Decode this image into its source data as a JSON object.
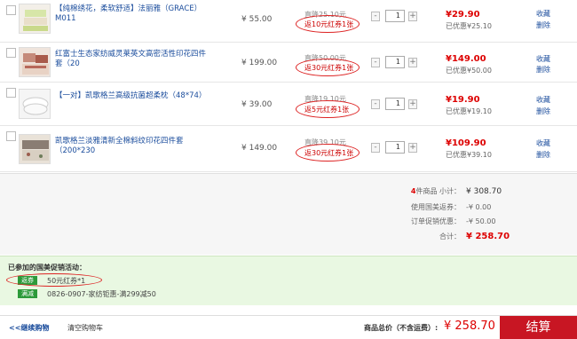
{
  "items": [
    {
      "name": "【纯棉绣花，柔软舒适】法丽雅（GRACE）M011",
      "price": "¥ 55.00",
      "discount": "直降25.10元",
      "coupon": "返10元红券1张",
      "qty": "1",
      "subtotal": "¥29.90",
      "saved": "已优惠¥25.10",
      "fav": "收藏",
      "del": "删除"
    },
    {
      "name": "红富士生态家纺威灵莱英文高密活性印花四件套（20",
      "price": "¥ 199.00",
      "discount": "直降50.00元",
      "coupon": "返30元红券1张",
      "qty": "1",
      "subtotal": "¥149.00",
      "saved": "已优惠¥50.00",
      "fav": "收藏",
      "del": "删除"
    },
    {
      "name": "【一对】凯歌格兰高级抗菌超柔枕（48*74）",
      "price": "¥ 39.00",
      "discount": "直降19.10元",
      "coupon": "返5元红券1张",
      "qty": "1",
      "subtotal": "¥19.90",
      "saved": "已优惠¥19.10",
      "fav": "收藏",
      "del": "删除"
    },
    {
      "name": "凯歌格兰淡雅清新全棉斜纹印花四件套（200*230",
      "price": "¥ 149.00",
      "discount": "直降39.10元",
      "coupon": "返30元红券1张",
      "qty": "1",
      "subtotal": "¥109.90",
      "saved": "已优惠¥39.10",
      "fav": "收藏",
      "del": "删除"
    }
  ],
  "summary": {
    "count_num": "4",
    "count_label": "件商品 小计：",
    "subtotal": "¥ 308.70",
    "coupon_label": "使用国美返券：",
    "coupon_value": "-¥ 0.00",
    "promo_label": "订单促销优惠：",
    "promo_value": "-¥ 50.00",
    "total_label": "合计：",
    "total_value": "¥ 258.70"
  },
  "promo": {
    "title": "已参加的国美促销活动：",
    "badge1": "返券",
    "text1": "50元红券*1",
    "badge2": "满减",
    "text2": "0826-0907-家纺钜惠-满299减50"
  },
  "footer": {
    "back": "<<继续购物",
    "clear": "清空购物车",
    "total_label": "商品总价（不含运费）:",
    "total_value": "¥ 258.70",
    "checkout": "结算"
  },
  "colors": {
    "accent": "#c81623",
    "link": "#1a4c9c",
    "promo_bg": "#e9f8e2",
    "badge": "#2d9a3a"
  }
}
